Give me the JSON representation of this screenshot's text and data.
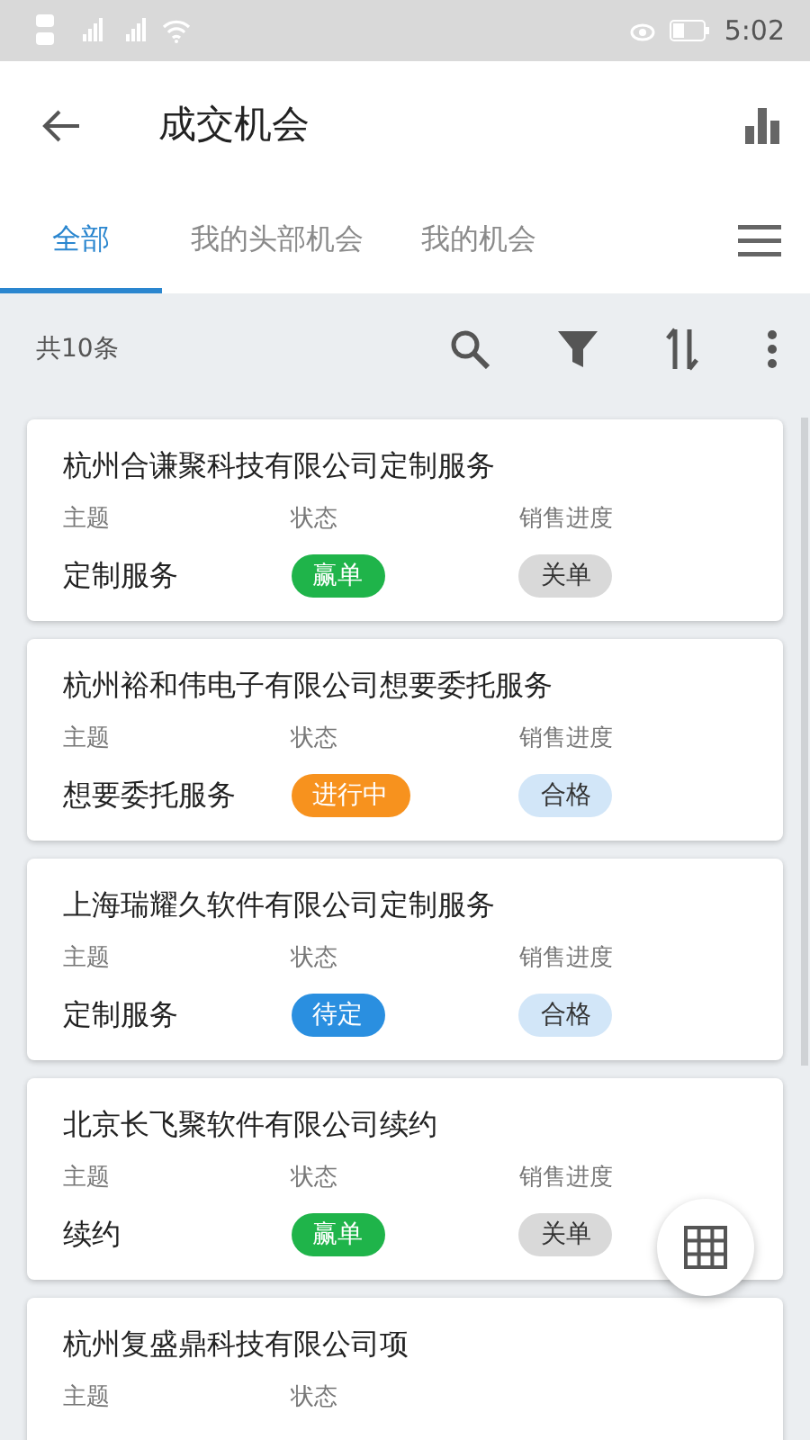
{
  "status_bar": {
    "time": "5:02"
  },
  "header": {
    "title": "成交机会"
  },
  "tabs": [
    {
      "label": "全部",
      "selected": true
    },
    {
      "label": "我的头部机会",
      "selected": false
    },
    {
      "label": "我的机会",
      "selected": false
    }
  ],
  "toolbar": {
    "count": "共10条"
  },
  "cards": [
    {
      "title": "杭州合谦聚科技有限公司定制服务",
      "subject_label": "主题",
      "status_label": "状态",
      "progress_label": "销售进度",
      "subject": "定制服务",
      "status": {
        "label": "赢单",
        "color": "#1fb44a"
      },
      "progress": {
        "label": "关单",
        "color": "#d9d9d9"
      }
    },
    {
      "title": "杭州裕和伟电子有限公司想要委托服务",
      "subject_label": "主题",
      "status_label": "状态",
      "progress_label": "销售进度",
      "subject": "想要委托服务",
      "status": {
        "label": "进行中",
        "color": "#f7921e"
      },
      "progress": {
        "label": "合格",
        "color": "#d2e6f8"
      }
    },
    {
      "title": "上海瑞耀久软件有限公司定制服务",
      "subject_label": "主题",
      "status_label": "状态",
      "progress_label": "销售进度",
      "subject": "定制服务",
      "status": {
        "label": "待定",
        "color": "#2a8fe0"
      },
      "progress": {
        "label": "合格",
        "color": "#d2e6f8"
      }
    },
    {
      "title": "北京长飞聚软件有限公司续约",
      "subject_label": "主题",
      "status_label": "状态",
      "progress_label": "销售进度",
      "subject": "续约",
      "status": {
        "label": "赢单",
        "color": "#1fb44a"
      },
      "progress": {
        "label": "关单",
        "color": "#d9d9d9"
      }
    },
    {
      "title": "杭州复盛鼎科技有限公司项",
      "subject_label": "主题",
      "status_label": "状态"
    }
  ]
}
